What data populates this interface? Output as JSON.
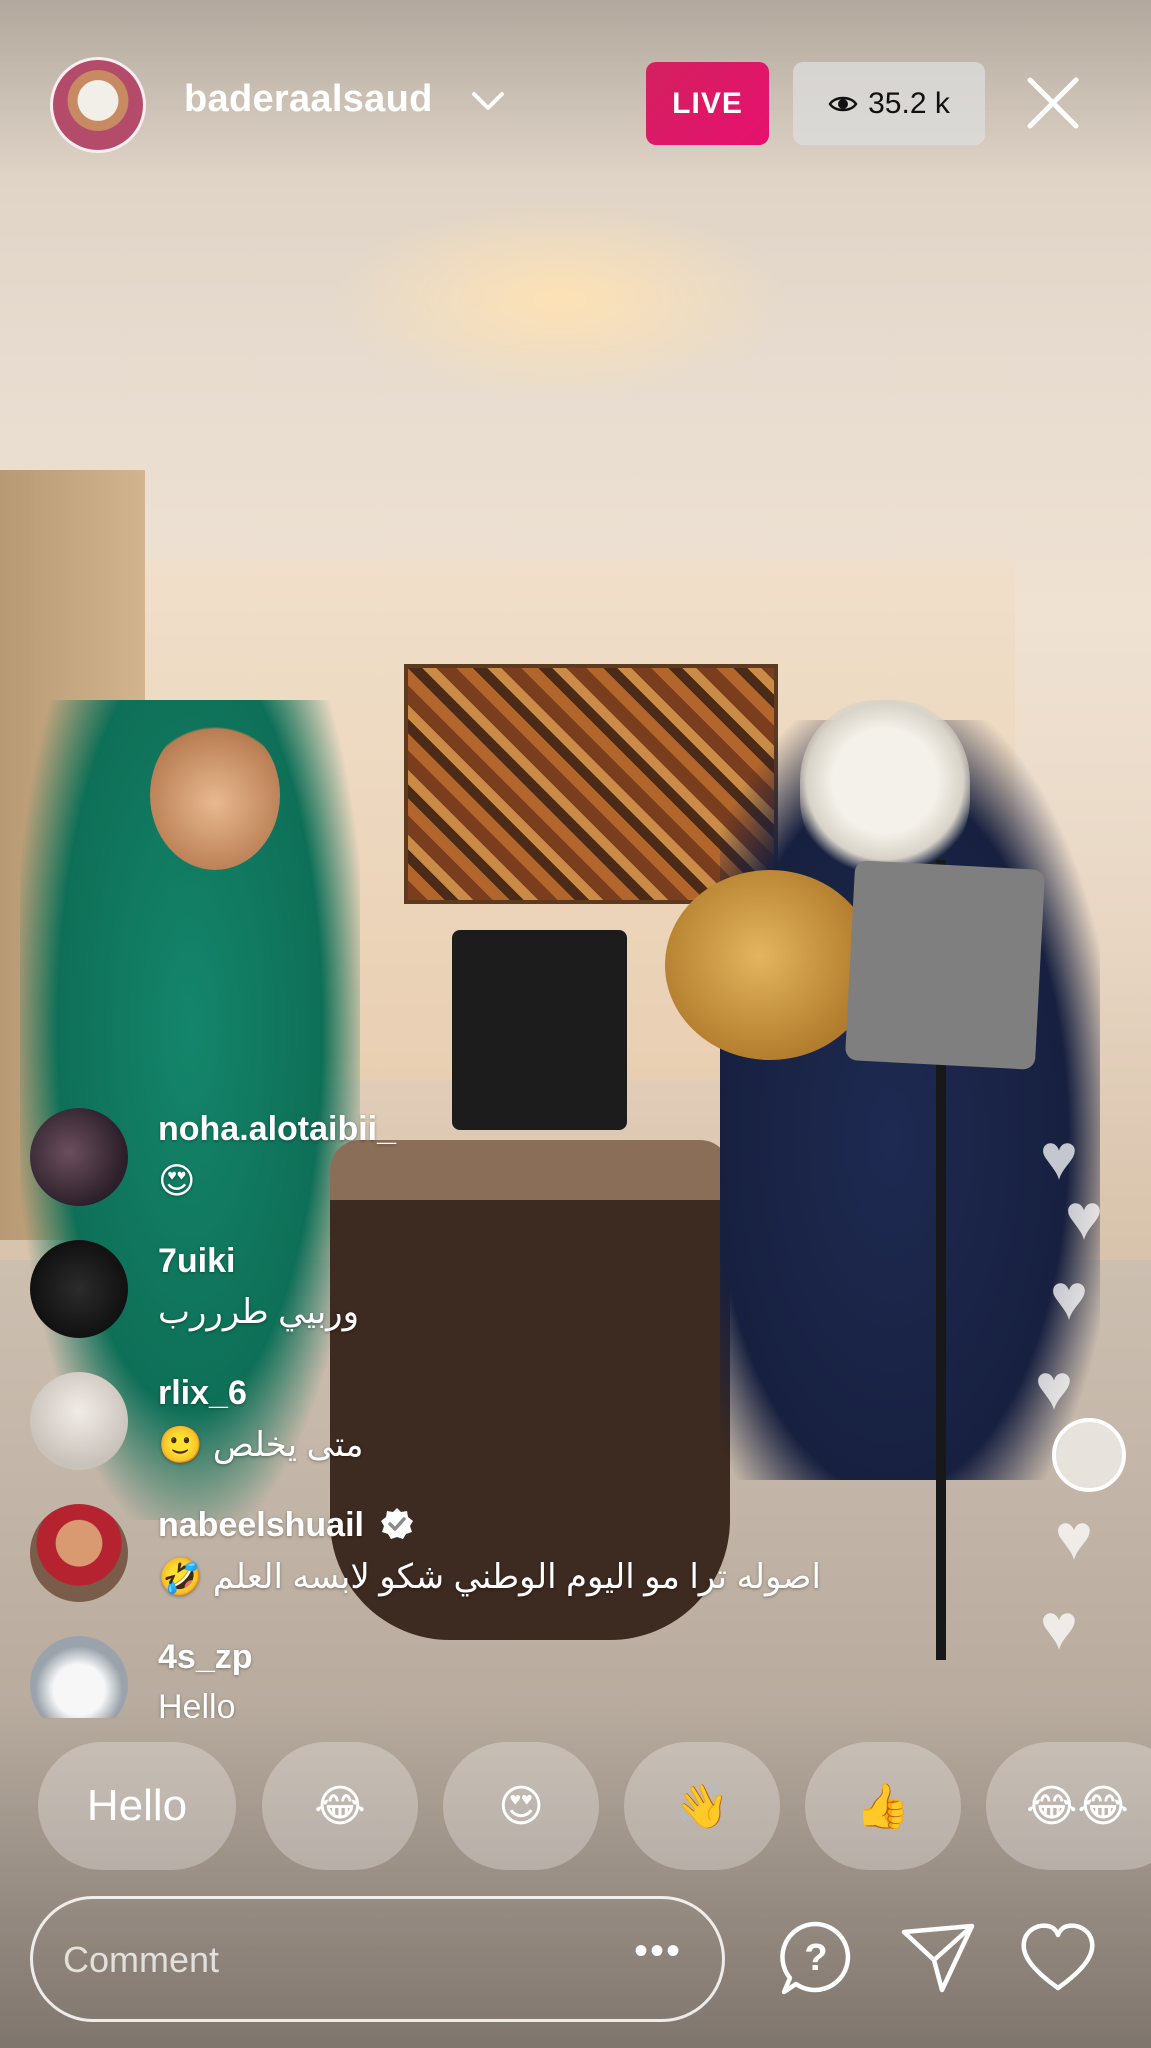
{
  "header": {
    "username": "baderaalsaud",
    "live_label": "LIVE",
    "viewer_count": "35.2 k"
  },
  "comments": [
    {
      "user": "noha.alotaibii_",
      "text": "",
      "emoji": "😍",
      "verified": false
    },
    {
      "user": "7uiki",
      "text": "وربيي طرررب",
      "emoji": "",
      "verified": false
    },
    {
      "user": "rlix_6",
      "text": "متى يخلص",
      "emoji": "🙂",
      "verified": false
    },
    {
      "user": "nabeelshuail",
      "text": "اصوله ترا مو اليوم الوطني شكو  لابسه العلم",
      "emoji": "🤣",
      "verified": true
    },
    {
      "user": "4s_zp",
      "text": "Hello",
      "emoji": "",
      "verified": false
    }
  ],
  "quick_replies": [
    "Hello",
    "😂",
    "😍",
    "👋",
    "👍",
    "😂😂"
  ],
  "composer": {
    "placeholder": "Comment",
    "more_label": "•••"
  },
  "icons": [
    "chevron-down-icon",
    "eye-icon",
    "close-icon",
    "verified-icon",
    "question-icon",
    "send-icon",
    "heart-icon"
  ]
}
